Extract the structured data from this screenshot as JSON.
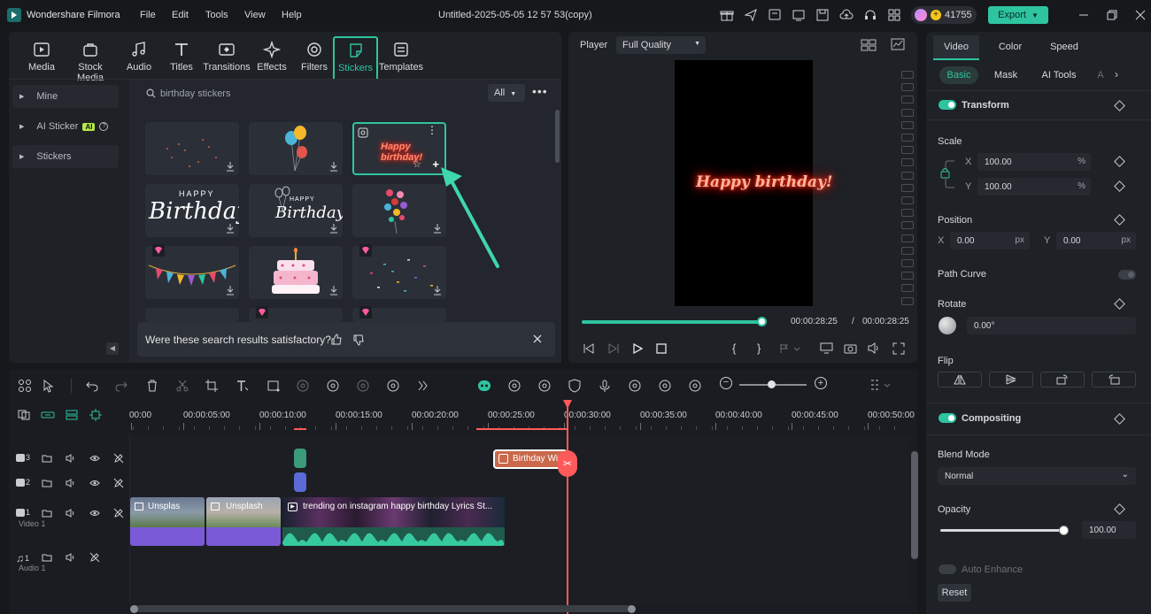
{
  "app": {
    "name": "Wondershare Filmora",
    "document_title": "Untitled-2025-05-05 12 57 53(copy)",
    "credits": "41755",
    "export_label": "Export"
  },
  "menu": [
    "File",
    "Edit",
    "Tools",
    "View",
    "Help"
  ],
  "media_tabs": [
    {
      "label": "Media",
      "icon": "media-icon"
    },
    {
      "label": "Stock Media",
      "icon": "stock-media-icon"
    },
    {
      "label": "Audio",
      "icon": "music-note-icon"
    },
    {
      "label": "Titles",
      "icon": "titles-icon"
    },
    {
      "label": "Transitions",
      "icon": "transitions-icon"
    },
    {
      "label": "Effects",
      "icon": "effects-icon"
    },
    {
      "label": "Filters",
      "icon": "filters-icon"
    },
    {
      "label": "Stickers",
      "icon": "stickers-icon",
      "active": true
    },
    {
      "label": "Templates",
      "icon": "templates-icon"
    }
  ],
  "sidebar": [
    {
      "label": "Mine"
    },
    {
      "label": "AI Sticker",
      "badge": "AI"
    },
    {
      "label": "Stickers"
    }
  ],
  "search": {
    "query": "birthday stickers",
    "filter": "All"
  },
  "stickers": [
    {
      "name": "sparkle-particles"
    },
    {
      "name": "balloons"
    },
    {
      "name": "neon-happy-birthday",
      "text": "Happy birthday!",
      "selected": true
    },
    {
      "name": "happy-birthday-script",
      "text1": "HAPPY",
      "text2": "Birthday"
    },
    {
      "name": "happy-birthday-balloons-script",
      "text1": "HAPPY",
      "text2": "Birthday"
    },
    {
      "name": "heart-balloons"
    },
    {
      "name": "bunting-flags",
      "premium": true
    },
    {
      "name": "birthday-cake"
    },
    {
      "name": "confetti",
      "premium": true
    }
  ],
  "feedback": {
    "question": "Were these search results satisfactory?"
  },
  "player": {
    "label": "Player",
    "quality": "Full Quality",
    "current_time": "00:00:28:25",
    "total_time": "00:00:28:25",
    "separator": "/",
    "overlay_text": "Happy birthday!",
    "progress_fraction": 1.0
  },
  "inspector": {
    "tabs": [
      "Video",
      "Color",
      "Speed"
    ],
    "subtabs": [
      "Basic",
      "Mask",
      "AI Tools",
      "A"
    ],
    "transform": "Transform",
    "scale_label": "Scale",
    "scale_x": "100.00",
    "scale_y": "100.00",
    "x": "X",
    "y": "Y",
    "percent": "%",
    "position_label": "Position",
    "pos_x": "0.00",
    "pos_y": "0.00",
    "px": "px",
    "path_curve": "Path Curve",
    "rotate_label": "Rotate",
    "rotate_value": "0.00°",
    "flip_label": "Flip",
    "compositing": "Compositing",
    "blend_label": "Blend Mode",
    "blend_value": "Normal",
    "opacity_label": "Opacity",
    "opacity_value": "100.00",
    "auto_enhance": "Auto Enhance",
    "reset": "Reset"
  },
  "ruler": [
    "00:00",
    "00:00:05:00",
    "00:00:10:00",
    "00:00:15:00",
    "00:00:20:00",
    "00:00:25:00",
    "00:00:30:00",
    "00:00:35:00",
    "00:00:40:00",
    "00:00:45:00",
    "00:00:50:00"
  ],
  "tracks": [
    {
      "id": "3",
      "type": "video"
    },
    {
      "id": "2",
      "type": "video"
    },
    {
      "id": "1",
      "type": "video",
      "name": "Video 1"
    },
    {
      "id": "1",
      "type": "audio",
      "name": "Audio 1"
    }
  ],
  "clips": {
    "sticker_clip": "Birthday Wi",
    "video_clip_1": "Unsplas",
    "video_clip_2": "Unsplash",
    "video_clip_3": "trending on instagram    happy birthday Lyrics St..."
  },
  "colors": {
    "accent": "#2ec4a0",
    "playhead": "#ff5a5a",
    "sticker_clip": "#d9664a",
    "video_clip": "#7a5ad6"
  }
}
